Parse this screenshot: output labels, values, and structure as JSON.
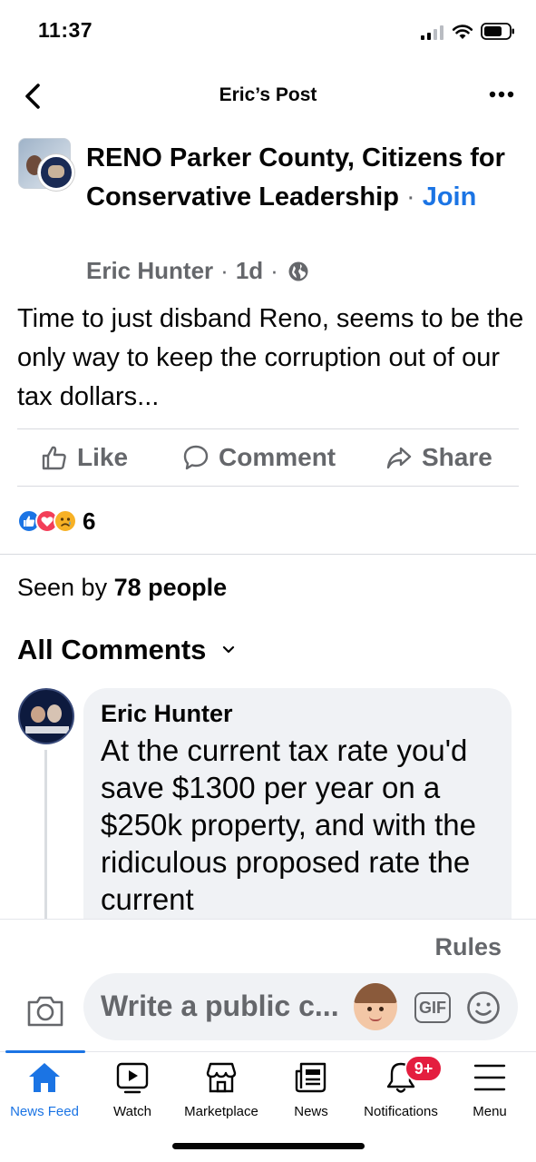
{
  "status_bar": {
    "time": "11:37"
  },
  "header": {
    "title": "Eric’s Post"
  },
  "post": {
    "group_name": "RENO Parker County, Citizens for Conservative Leadership",
    "separator": " · ",
    "join_label": "Join",
    "author": "Eric Hunter",
    "dot": "·",
    "time_ago": "1d",
    "text": "Time to just disband Reno, seems to be the only way to keep the corruption out of our tax dollars...",
    "reaction_count": "6",
    "reactions": [
      "like",
      "love",
      "sad"
    ]
  },
  "actions": {
    "like_label": "Like",
    "comment_label": "Comment",
    "share_label": "Share"
  },
  "seen_by": {
    "prefix": "Seen by",
    "count_text": "78 people"
  },
  "comments": {
    "filter_label": "All Comments",
    "items": [
      {
        "author": "Eric Hunter",
        "text": "At the current tax rate you'd save $1300 per year on a $250k property, and with the ridiculous proposed rate the current"
      }
    ]
  },
  "composer": {
    "rules_label": "Rules",
    "placeholder": "Write a public c...",
    "gif_label": "GIF"
  },
  "bottom_nav": {
    "items": [
      {
        "label": "News Feed",
        "icon": "home-icon",
        "active": true
      },
      {
        "label": "Watch",
        "icon": "watch-icon"
      },
      {
        "label": "Marketplace",
        "icon": "marketplace-icon"
      },
      {
        "label": "News",
        "icon": "news-icon"
      },
      {
        "label": "Notifications",
        "icon": "bell-icon",
        "badge": "9+"
      },
      {
        "label": "Menu",
        "icon": "menu-icon"
      }
    ]
  },
  "colors": {
    "accent": "#1b74e4",
    "secondary_text": "#65676b",
    "badge": "#e41e3f",
    "bubble": "#f0f2f5"
  }
}
